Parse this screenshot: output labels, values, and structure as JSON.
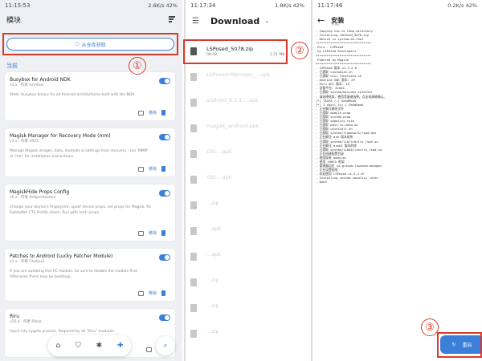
{
  "left": {
    "status_time": "11:15:53",
    "status_right": "2.6K/s 42%",
    "title": "模块",
    "repo_button": "从仓库获取",
    "section": "当前",
    "modules": [
      {
        "name": "Busybox for Android NDK",
        "version": "v1.x · 作者 osm0sis",
        "desc": "Static busybox binary for all Android architectures built with the NDK.",
        "action": "移除"
      },
      {
        "name": "Magisk Manager for Recovery Mode (mm)",
        "version": "v7.x · 作者 VR25",
        "desc": "Manage Magisk images, data, modules & settings from recovery - run 'MMM' or 'mm' for installation instructions.",
        "action": "移除"
      },
      {
        "name": "MagiskHide Props Config",
        "version": "v6.x · 作者 Didgeridoohan",
        "desc": "Change your device's fingerprint, spoof device props, set props for Magisk, fix SafetyNet CTS Profile check. Run with root: props.",
        "action": "移除"
      },
      {
        "name": "Patches to Android (Lucky Patcher Module)",
        "version": "v1.x · 作者 ChelpuS",
        "desc": "If you are updating this PC module, be sure to disable the module first. Otherwise there may be bootloop.",
        "action": "移除"
      },
      {
        "name": "Riru",
        "version": "v25.4 · 作者 Rikka",
        "desc": "Inject into zygote process. Required by all \"Riru\" modules.",
        "action": ""
      }
    ],
    "nav_icons": [
      "home-icon",
      "shield-icon",
      "bug-icon",
      "puzzle-icon"
    ],
    "badge": "①"
  },
  "middle": {
    "status_time": "11:17:34",
    "status_right": "1.8K/s 42%",
    "title": "Download",
    "files": [
      {
        "name": "LSPosed_5078.zip",
        "meta": "08:49",
        "size": "2.21 MB",
        "highlight": true
      },
      {
        "name": "LSPosed-Manager_...apk",
        "meta": "",
        "size": "",
        "highlight": false
      },
      {
        "name": "android_9.1.1-...apk",
        "meta": "",
        "size": "",
        "highlight": false
      },
      {
        "name": "magisk_android.apk",
        "meta": "",
        "size": "",
        "highlight": false
      },
      {
        "name": "GSI-...apk",
        "meta": "",
        "size": "",
        "highlight": false
      },
      {
        "name": "GSI-...apk",
        "meta": "",
        "size": "",
        "highlight": false
      },
      {
        "name": "...zip",
        "meta": "",
        "size": "",
        "highlight": false
      },
      {
        "name": "...apk",
        "meta": "",
        "size": "",
        "highlight": false
      },
      {
        "name": "...apk",
        "meta": "",
        "size": "",
        "highlight": false
      },
      {
        "name": "...zip",
        "meta": "",
        "size": "",
        "highlight": false
      },
      {
        "name": "...zip",
        "meta": "",
        "size": "",
        "highlight": false
      },
      {
        "name": "...zip",
        "meta": "",
        "size": "",
        "highlight": false
      }
    ],
    "badge": "②"
  },
  "right": {
    "status_time": "11:17:46",
    "status_right": "0.2K/s 42%",
    "title": "安装",
    "subtitle": "完成。",
    "log": [
      "- Copying zip to temp directory",
      "- Installing LSPosed_5078.zip",
      "- Device is system-as-root",
      "******************************",
      " Riru - LSPosed",
      " by LSPosed Developers",
      "******************************",
      " Powered by Magisk",
      "******************************",
      "- LSPosed 版本 v1.5.2.0",
      "- 已提取 customize.sh",
      "- 已提取 util_functions.sh",
      "- Android SDK 版本: 29",
      "- Riru API 版本: 10",
      "- 设备平台: arm64",
      "- 已提取 system/bin/dex_selector",
      "- 请选择框架，使用音量键选择，点击电源键确认。",
      "[*] TAIPA (-) SandHook",
      "[*] 1 cpoll_is(-) SandHook",
      "- 正在解压模块文件",
      "- 已提取 module.prop",
      "- 已提取 system.prop",
      "- 已提取 sepolicy.rule",
      "- 已提取 post-fs-data.sh",
      "- 已提取 uninstall.sh",
      "- 已提取 system/framework/lspd.dex",
      "- 正在解压 arm 版本的库",
      "- 已提取 system/lib/libriru_lspd.so",
      "- 正在解压 arm64 版本的库",
      "- 已提取 system/lib64/libriru_lspd.so",
      "- 正在创建配置目录",
      "- 使用现有 modules",
      "- 使用 YAHFA 框架",
      "- 管理器包名 io.github.lsposed.manager",
      "- 正在设置权限",
      "- 欢迎使用 LSPosed v1.5.2.0!",
      "- Installing custom sepolicy rules",
      "- Done"
    ],
    "reboot_label": "重启",
    "badge": "③"
  },
  "colors": {
    "accent": "#3b7fd9",
    "annotation": "#d9392c"
  }
}
